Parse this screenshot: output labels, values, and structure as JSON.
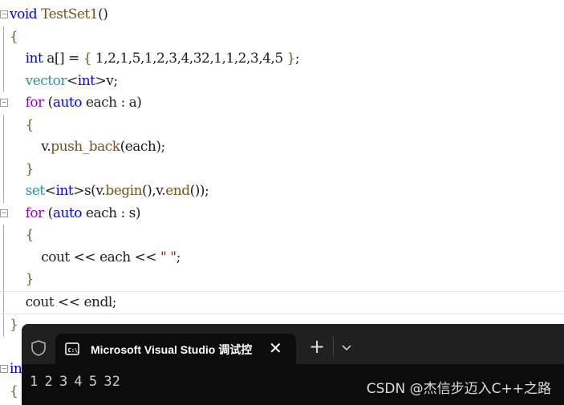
{
  "editor": {
    "lines": [
      "void TestSet1()",
      "{",
      "int a[] = { 1,2,1,5,1,2,3,4,32,1,1,2,3,4,5 };",
      "vector<int>v;",
      "for (auto each : a)",
      "{",
      "v.push_back(each);",
      "}",
      "set<int>s(v.begin(),v.end());",
      "for (auto each : s)",
      "{",
      "cout << each << \" \";",
      "}",
      "cout << endl;",
      "}",
      "int main()",
      "{"
    ]
  },
  "terminal": {
    "tab_title": "Microsoft Visual Studio 调试控",
    "output": "1 2 3 4 5 32",
    "icons": [
      "shield-icon",
      "terminal-icon",
      "close-icon",
      "plus-icon",
      "chevron-down-icon"
    ]
  },
  "watermark": "CSDN @杰信步迈入C++之路"
}
